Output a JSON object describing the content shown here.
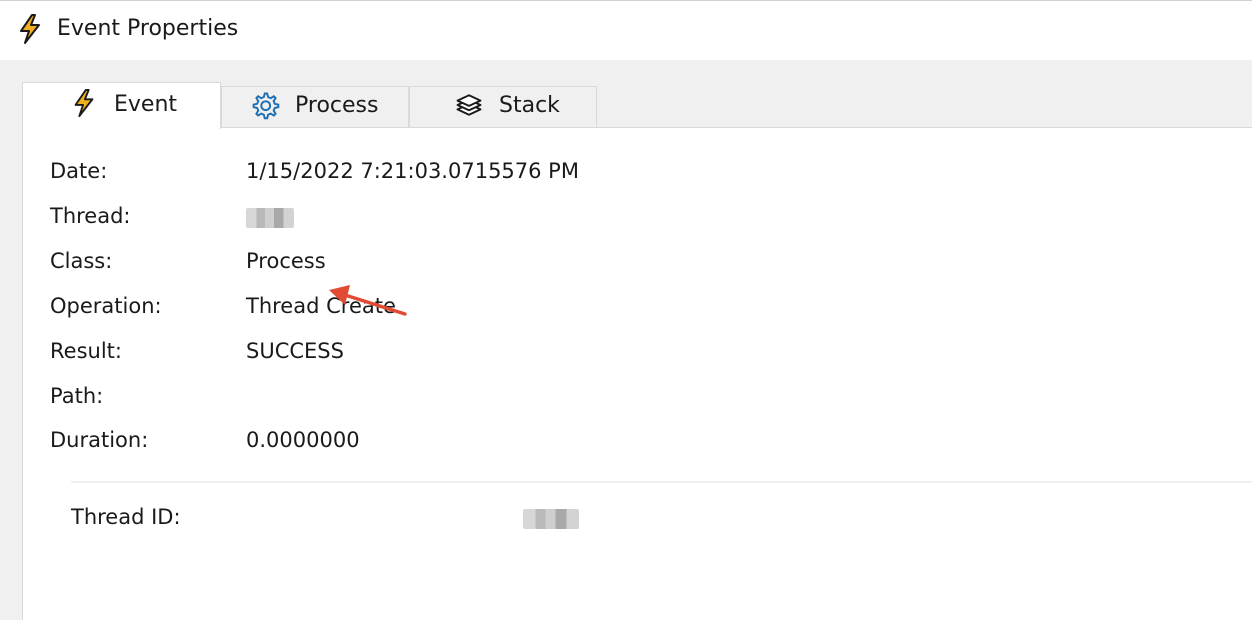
{
  "window": {
    "title": "Event Properties",
    "title_icon": "lightning-icon"
  },
  "tabs": [
    {
      "label": "Event",
      "icon": "lightning-icon",
      "active": true
    },
    {
      "label": "Process",
      "icon": "gear-icon",
      "active": false
    },
    {
      "label": "Stack",
      "icon": "layers-icon",
      "active": false
    }
  ],
  "event": {
    "date_label": "Date:",
    "date_value": "1/15/2022 7:21:03.0715576 PM",
    "thread_label": "Thread:",
    "class_label": "Class:",
    "class_value": "Process",
    "operation_label": "Operation:",
    "operation_value": "Thread Create",
    "result_label": "Result:",
    "result_value": "SUCCESS",
    "path_label": "Path:",
    "path_value": "",
    "duration_label": "Duration:",
    "duration_value": "0.0000000"
  },
  "details": {
    "thread_id_label": "Thread ID:"
  },
  "colors": {
    "accent_lightning": "#e8a317",
    "gear_blue": "#1f6fb5",
    "annotation_arrow": "#e24a33"
  }
}
